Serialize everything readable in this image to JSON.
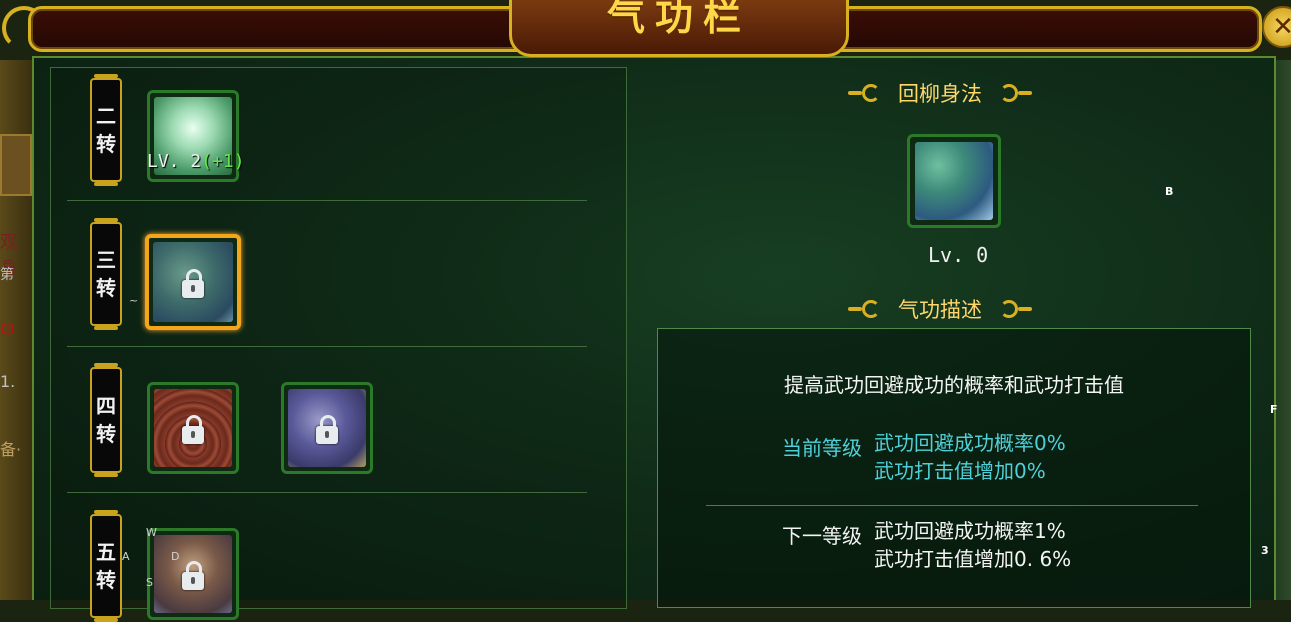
{
  "window": {
    "title": "气功栏",
    "close_label": "✕"
  },
  "tiers": [
    {
      "label_top": "二",
      "label_bottom": "转",
      "skills": [
        {
          "locked": false,
          "level": "LV. 2",
          "bonus": "(+1)"
        }
      ]
    },
    {
      "label_top": "三",
      "label_bottom": "转",
      "skills": [
        {
          "locked": true,
          "selected": true
        }
      ]
    },
    {
      "label_top": "四",
      "label_bottom": "转",
      "skills": [
        {
          "locked": true
        },
        {
          "locked": true
        }
      ]
    },
    {
      "label_top": "五",
      "label_bottom": "转",
      "skills": [
        {
          "locked": true
        }
      ]
    }
  ],
  "detail": {
    "skill_name": "回柳身法",
    "level": "Lv. 0",
    "desc_header": "气功描述",
    "description": "提高武功回避成功的概率和武功打击值",
    "current_label": "当前等级",
    "current_lines": [
      "武功回避成功概率0%",
      "武功打击值增加0%"
    ],
    "next_label": "下一等级",
    "next_lines": [
      "武功回避成功概率1%",
      "武功打击值增加0. 6%"
    ]
  },
  "key_hints": [
    "B",
    "F",
    "3",
    "W",
    "A",
    "D",
    "S",
    "~"
  ],
  "background_text": [
    "观身",
    "第",
    "卬",
    "1.",
    "备·"
  ],
  "colors": {
    "gold": "#d8b020",
    "title_gold": "#ffd84a",
    "current_cyan": "#4fd0d8",
    "next_white": "#f4f4f4",
    "bonus_green": "#5fe84a",
    "selected_orange": "#f5a51a"
  }
}
